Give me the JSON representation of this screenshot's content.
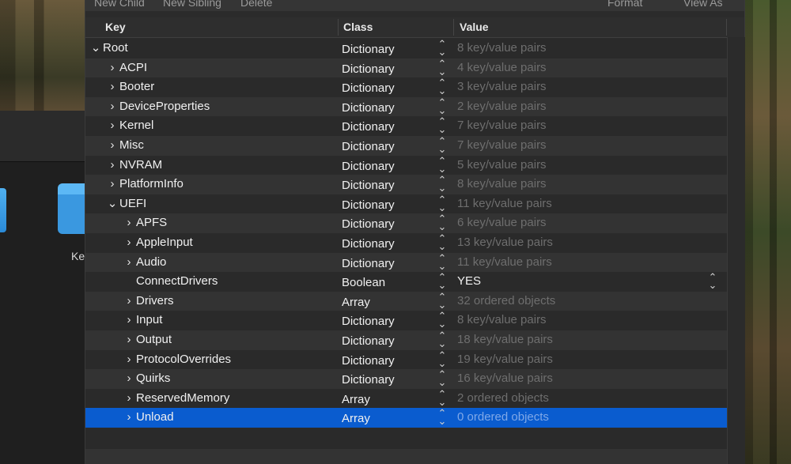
{
  "toolbar": {
    "new_child": "New Child",
    "new_sibling": "New Sibling",
    "delete": "Delete",
    "format": "Format",
    "view_as": "View As"
  },
  "header": {
    "key": "Key",
    "class": "Class",
    "value": "Value"
  },
  "desktop": {
    "folder_label": "Ke"
  },
  "rows": [
    {
      "chevron": "⌄",
      "key": "Root",
      "class": "Dictionary",
      "value": "8 key/value pairs"
    },
    {
      "chevron": "›",
      "key": "ACPI",
      "class": "Dictionary",
      "value": "4 key/value pairs"
    },
    {
      "chevron": "›",
      "key": "Booter",
      "class": "Dictionary",
      "value": "3 key/value pairs"
    },
    {
      "chevron": "›",
      "key": "DeviceProperties",
      "class": "Dictionary",
      "value": "2 key/value pairs"
    },
    {
      "chevron": "›",
      "key": "Kernel",
      "class": "Dictionary",
      "value": "7 key/value pairs"
    },
    {
      "chevron": "›",
      "key": "Misc",
      "class": "Dictionary",
      "value": "7 key/value pairs"
    },
    {
      "chevron": "›",
      "key": "NVRAM",
      "class": "Dictionary",
      "value": "5 key/value pairs"
    },
    {
      "chevron": "›",
      "key": "PlatformInfo",
      "class": "Dictionary",
      "value": "8 key/value pairs"
    },
    {
      "chevron": "⌄",
      "key": "UEFI",
      "class": "Dictionary",
      "value": "11 key/value pairs"
    },
    {
      "chevron": "›",
      "key": "APFS",
      "class": "Dictionary",
      "value": "6 key/value pairs"
    },
    {
      "chevron": "›",
      "key": "AppleInput",
      "class": "Dictionary",
      "value": "13 key/value pairs"
    },
    {
      "chevron": "›",
      "key": "Audio",
      "class": "Dictionary",
      "value": "11 key/value pairs"
    },
    {
      "chevron": "",
      "key": "ConnectDrivers",
      "class": "Boolean",
      "value": "YES"
    },
    {
      "chevron": "›",
      "key": "Drivers",
      "class": "Array",
      "value": "32 ordered objects"
    },
    {
      "chevron": "›",
      "key": "Input",
      "class": "Dictionary",
      "value": "8 key/value pairs"
    },
    {
      "chevron": "›",
      "key": "Output",
      "class": "Dictionary",
      "value": "18 key/value pairs"
    },
    {
      "chevron": "›",
      "key": "ProtocolOverrides",
      "class": "Dictionary",
      "value": "19 key/value pairs"
    },
    {
      "chevron": "›",
      "key": "Quirks",
      "class": "Dictionary",
      "value": "16 key/value pairs"
    },
    {
      "chevron": "›",
      "key": "ReservedMemory",
      "class": "Array",
      "value": "2 ordered objects"
    },
    {
      "chevron": "›",
      "key": "Unload",
      "class": "Array",
      "value": "0 ordered objects"
    }
  ],
  "colors": {
    "selection": "#0a5ccf",
    "row_odd": "#2a2a2a",
    "row_even": "#333333",
    "dim_value": "#6e6e6e"
  }
}
